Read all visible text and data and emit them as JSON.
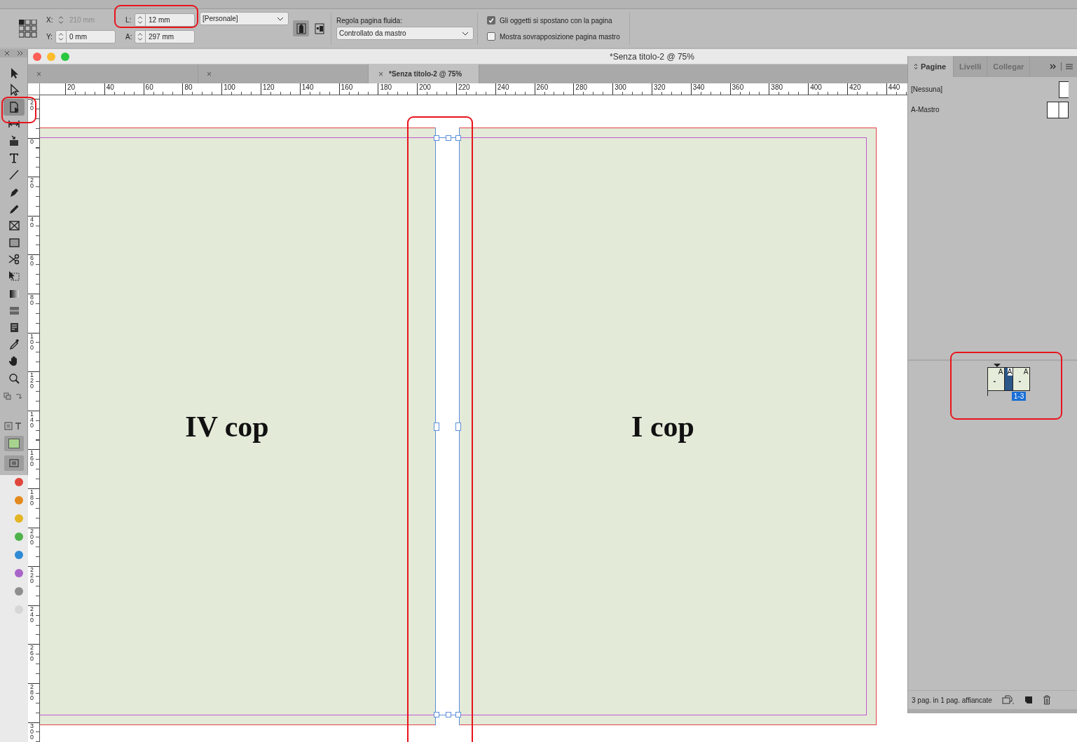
{
  "control_bar": {
    "fields": [
      {
        "label": "X:",
        "value": "210 mm",
        "disabled": true
      },
      {
        "label": "L:",
        "value": "12 mm",
        "disabled": false
      },
      {
        "label": "Y:",
        "value": "0 mm",
        "disabled": false
      },
      {
        "label": "A:",
        "value": "297 mm",
        "disabled": false
      }
    ],
    "preset": "[Personale]",
    "fluid_label": "Regola pagina fluida:",
    "fluid_value": "Controllato da mastro",
    "options": [
      {
        "label": "Gli oggetti si spostano con la pagina",
        "checked": true
      },
      {
        "label": "Mostra sovrapposizione pagina mastro",
        "checked": false
      }
    ]
  },
  "window": {
    "title": "*Senza titolo-2 @ 75%"
  },
  "tabs": [
    {
      "close": "×",
      "selected": false
    },
    {
      "close": "×",
      "selected": false
    },
    {
      "close": "×",
      "label": "*Senza titolo-2 @ 75%",
      "selected": true
    }
  ],
  "tools": [
    {
      "kind": "selection",
      "selected": false
    },
    {
      "kind": "direct-selection",
      "selected": false
    },
    {
      "kind": "page",
      "selected": true
    },
    {
      "kind": "gap",
      "selected": false
    },
    {
      "kind": "content-collector",
      "selected": false
    },
    {
      "kind": "type",
      "selected": false
    },
    {
      "kind": "line",
      "selected": false
    },
    {
      "kind": "pen",
      "selected": false
    },
    {
      "kind": "pencil",
      "selected": false
    },
    {
      "kind": "frame",
      "selected": false
    },
    {
      "kind": "rectangle",
      "selected": false
    },
    {
      "kind": "scissors",
      "selected": false
    },
    {
      "kind": "free-transform",
      "selected": false
    },
    {
      "kind": "gradient",
      "selected": false
    },
    {
      "kind": "gradient-feather",
      "selected": false
    },
    {
      "kind": "note",
      "selected": false
    },
    {
      "kind": "eyedropper",
      "selected": false
    },
    {
      "kind": "hand",
      "selected": false
    },
    {
      "kind": "zoom",
      "selected": false
    }
  ],
  "color_tags": [
    {
      "color": "#e0463c"
    },
    {
      "color": "#e38a1e"
    },
    {
      "color": "#e3b523"
    },
    {
      "color": "#4db34a"
    },
    {
      "color": "#2f8ad4"
    },
    {
      "color": "#a865c7"
    },
    {
      "color": "#8e8e8e"
    },
    {
      "color": "#d6d6d6"
    }
  ],
  "rulers": {
    "horizontal": [
      "20",
      "40",
      "60",
      "80",
      "100",
      "120",
      "140",
      "160",
      "180",
      "200",
      "220",
      "240",
      "260",
      "280",
      "300",
      "320",
      "340",
      "360",
      "380",
      "400",
      "420",
      "440"
    ],
    "vertical": [
      "20",
      "0",
      "20",
      "40",
      "60",
      "80",
      "100",
      "120",
      "140",
      "160",
      "180",
      "200",
      "220",
      "240",
      "260",
      "280",
      "300"
    ]
  },
  "spread": {
    "pages": [
      {
        "label": "IV cop"
      },
      {
        "label": "I cop"
      }
    ]
  },
  "panel": {
    "tabs": [
      {
        "label": "Pagine",
        "selected": true
      },
      {
        "label": "Livelli",
        "selected": false
      },
      {
        "label": "Collegar",
        "selected": false
      }
    ],
    "masters": [
      {
        "label": "[Nessuna]",
        "kind": "single"
      },
      {
        "label": "A-Mastro",
        "kind": "double"
      }
    ],
    "spread_pages": [
      {
        "master": "A",
        "number": "-",
        "selected": false
      },
      {
        "master": "A",
        "selected": true
      },
      {
        "master": "A",
        "number": "-",
        "selected": false
      }
    ],
    "spread_label": "1-3",
    "status": "3 pag. in 1 pag. affiancate"
  }
}
